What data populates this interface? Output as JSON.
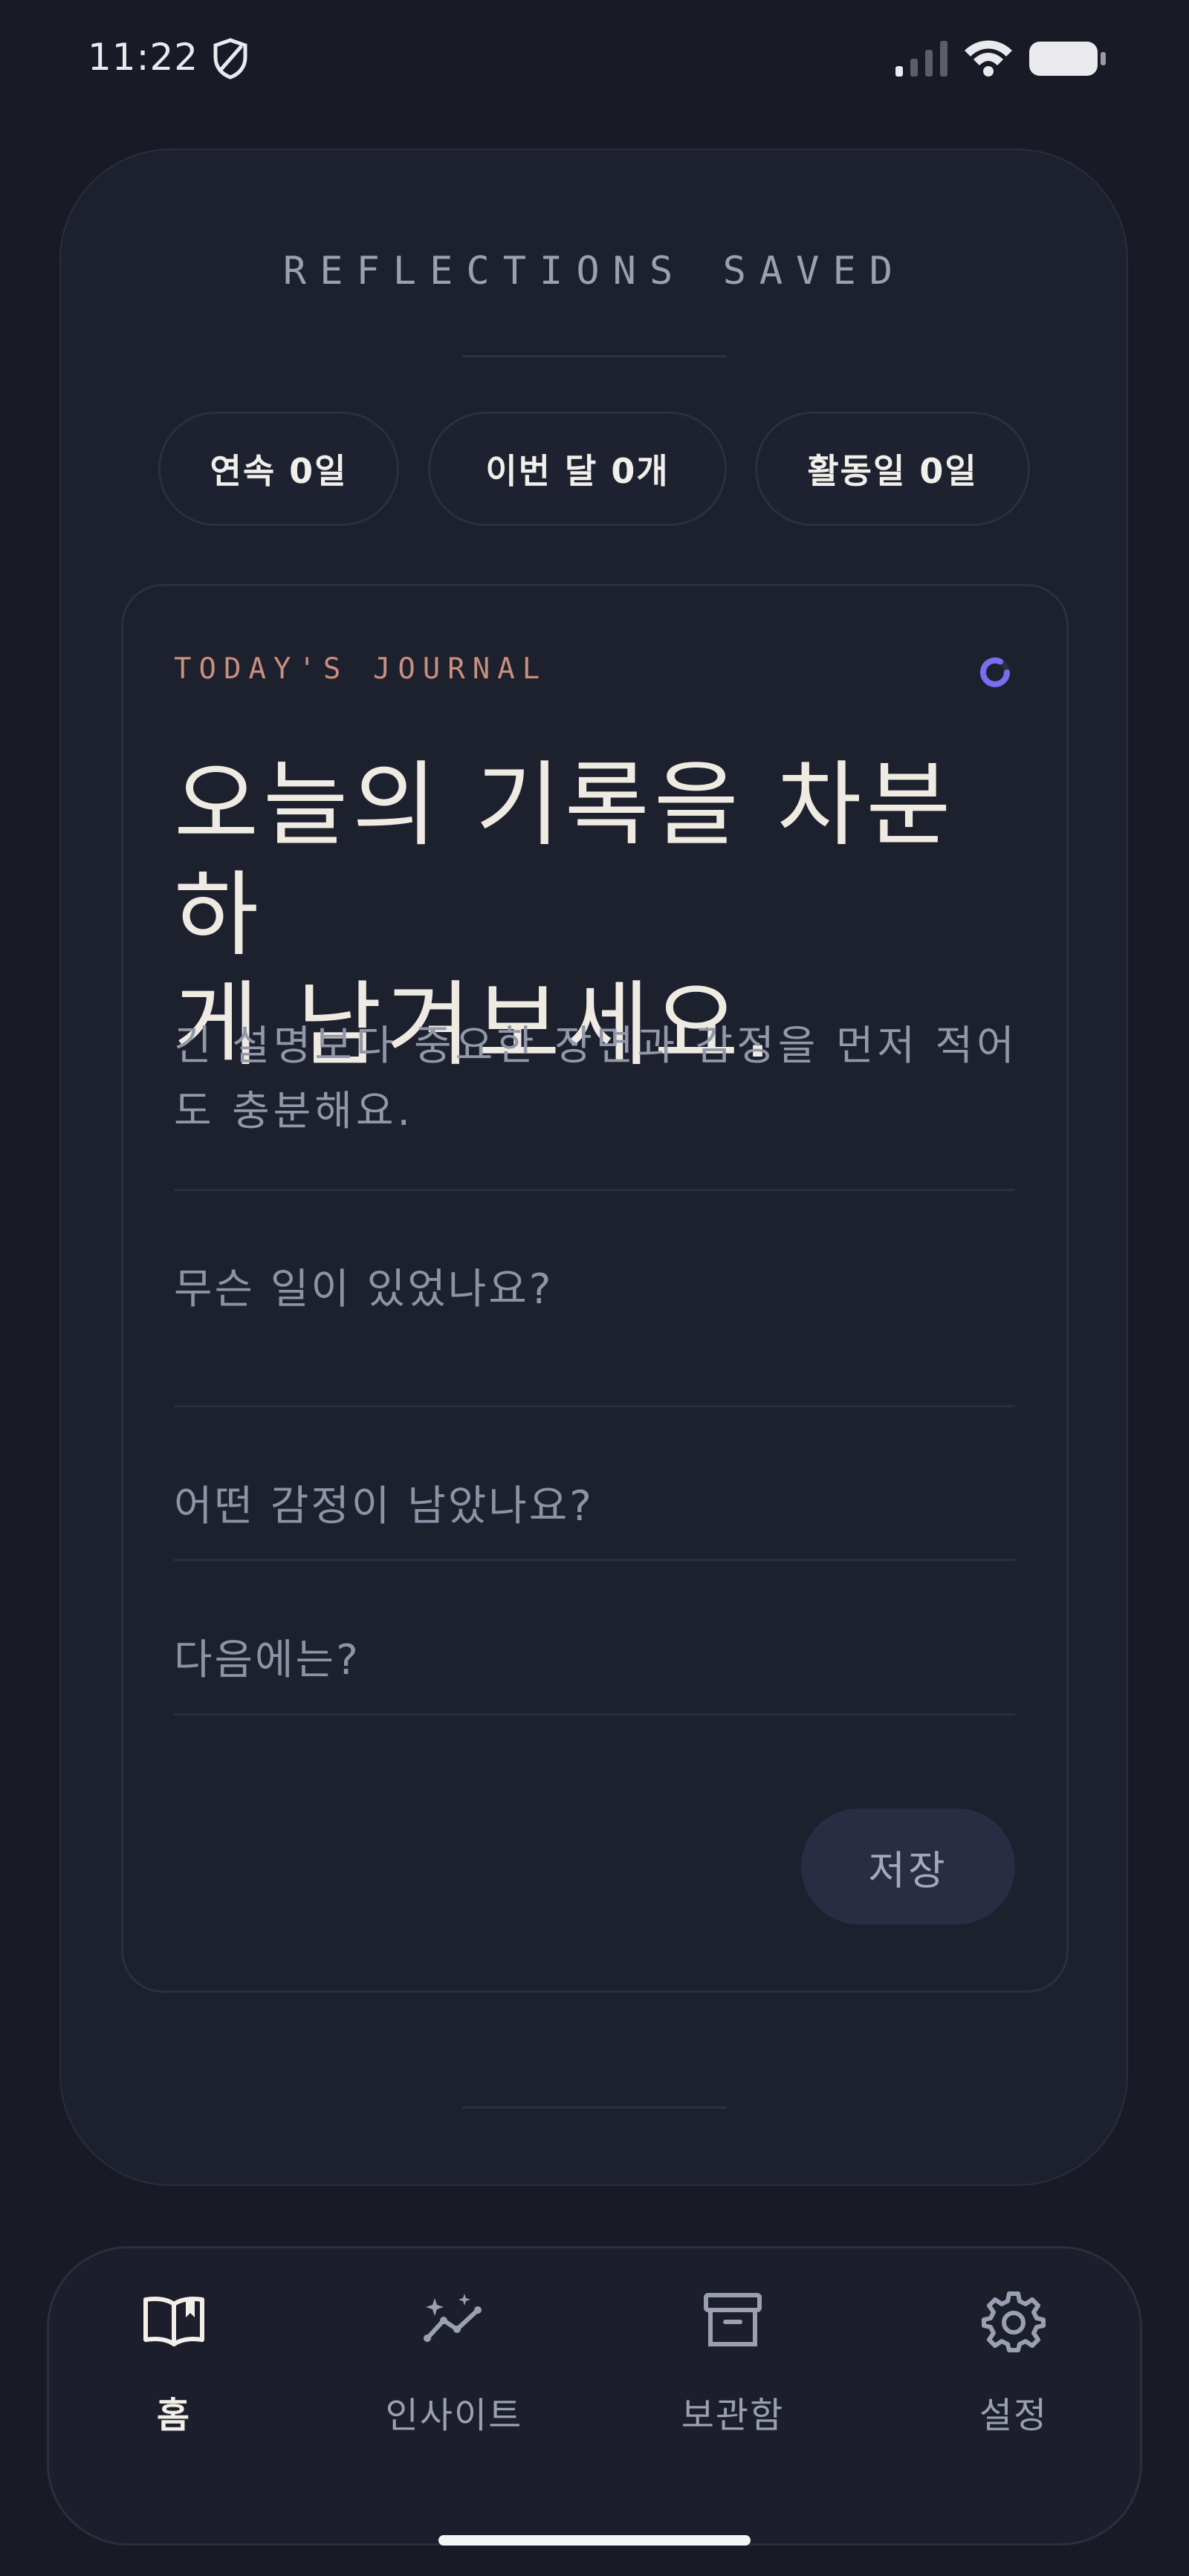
{
  "status_bar": {
    "time": "11:22"
  },
  "header": {
    "kicker": "REFLECTIONS SAVED"
  },
  "stats": [
    {
      "label": "연속 0일"
    },
    {
      "label": "이번 달 0개"
    },
    {
      "label": "활동일 0일"
    }
  ],
  "journal": {
    "kicker": "TODAY'S JOURNAL",
    "headline_line1": "오늘의 기록을 차분하",
    "headline_line2": "게 남겨보세요.",
    "subtext_line1": "긴 설명보다 중요한 장면과 감정을 먼저 적어",
    "subtext_line2": "도 충분해요.",
    "fields": [
      {
        "placeholder": "무슨 일이 있었나요?"
      },
      {
        "placeholder": "어떤 감정이 남았나요?"
      },
      {
        "placeholder": "다음에는?"
      }
    ],
    "save_label": "저장"
  },
  "nav": {
    "items": [
      {
        "label": "홈",
        "icon": "book-open-icon",
        "active": true
      },
      {
        "label": "인사이트",
        "icon": "sparkle-chart-icon",
        "active": false
      },
      {
        "label": "보관함",
        "icon": "archive-icon",
        "active": false
      },
      {
        "label": "설정",
        "icon": "gear-icon",
        "active": false
      }
    ]
  },
  "colors": {
    "background": "#181b26",
    "card": "#1d202d",
    "accent_kicker": "#c88f7e",
    "spinner": "#7b6cf0"
  }
}
